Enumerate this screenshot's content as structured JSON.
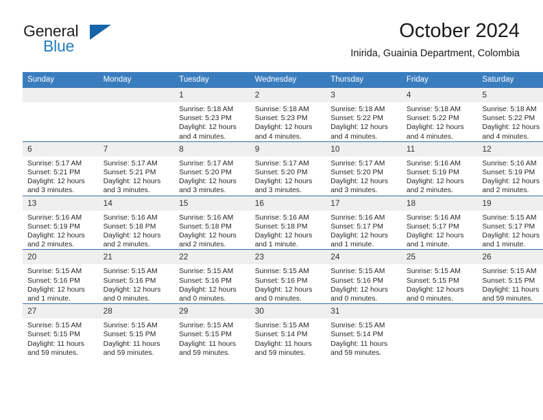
{
  "brand": {
    "name_part1": "General",
    "name_part2": "Blue",
    "triangle_color": "#1565a8"
  },
  "header": {
    "title": "October 2024",
    "location": "Inirida, Guainia Department, Colombia"
  },
  "theme": {
    "header_row_bg": "#3a7dbf",
    "row_divider": "#2f6eae",
    "daynum_bg": "#efefef",
    "text": "#262626"
  },
  "weekday_headers": [
    "Sunday",
    "Monday",
    "Tuesday",
    "Wednesday",
    "Thursday",
    "Friday",
    "Saturday"
  ],
  "weeks": [
    [
      {
        "day": "",
        "empty": true,
        "sunrise": "",
        "sunset": "",
        "daylight1": "",
        "daylight2": ""
      },
      {
        "day": "",
        "empty": true,
        "sunrise": "",
        "sunset": "",
        "daylight1": "",
        "daylight2": ""
      },
      {
        "day": "1",
        "sunrise": "Sunrise: 5:18 AM",
        "sunset": "Sunset: 5:23 PM",
        "daylight1": "Daylight: 12 hours",
        "daylight2": "and 4 minutes."
      },
      {
        "day": "2",
        "sunrise": "Sunrise: 5:18 AM",
        "sunset": "Sunset: 5:23 PM",
        "daylight1": "Daylight: 12 hours",
        "daylight2": "and 4 minutes."
      },
      {
        "day": "3",
        "sunrise": "Sunrise: 5:18 AM",
        "sunset": "Sunset: 5:22 PM",
        "daylight1": "Daylight: 12 hours",
        "daylight2": "and 4 minutes."
      },
      {
        "day": "4",
        "sunrise": "Sunrise: 5:18 AM",
        "sunset": "Sunset: 5:22 PM",
        "daylight1": "Daylight: 12 hours",
        "daylight2": "and 4 minutes."
      },
      {
        "day": "5",
        "sunrise": "Sunrise: 5:18 AM",
        "sunset": "Sunset: 5:22 PM",
        "daylight1": "Daylight: 12 hours",
        "daylight2": "and 4 minutes."
      }
    ],
    [
      {
        "day": "6",
        "sunrise": "Sunrise: 5:17 AM",
        "sunset": "Sunset: 5:21 PM",
        "daylight1": "Daylight: 12 hours",
        "daylight2": "and 3 minutes."
      },
      {
        "day": "7",
        "sunrise": "Sunrise: 5:17 AM",
        "sunset": "Sunset: 5:21 PM",
        "daylight1": "Daylight: 12 hours",
        "daylight2": "and 3 minutes."
      },
      {
        "day": "8",
        "sunrise": "Sunrise: 5:17 AM",
        "sunset": "Sunset: 5:20 PM",
        "daylight1": "Daylight: 12 hours",
        "daylight2": "and 3 minutes."
      },
      {
        "day": "9",
        "sunrise": "Sunrise: 5:17 AM",
        "sunset": "Sunset: 5:20 PM",
        "daylight1": "Daylight: 12 hours",
        "daylight2": "and 3 minutes."
      },
      {
        "day": "10",
        "sunrise": "Sunrise: 5:17 AM",
        "sunset": "Sunset: 5:20 PM",
        "daylight1": "Daylight: 12 hours",
        "daylight2": "and 3 minutes."
      },
      {
        "day": "11",
        "sunrise": "Sunrise: 5:16 AM",
        "sunset": "Sunset: 5:19 PM",
        "daylight1": "Daylight: 12 hours",
        "daylight2": "and 2 minutes."
      },
      {
        "day": "12",
        "sunrise": "Sunrise: 5:16 AM",
        "sunset": "Sunset: 5:19 PM",
        "daylight1": "Daylight: 12 hours",
        "daylight2": "and 2 minutes."
      }
    ],
    [
      {
        "day": "13",
        "sunrise": "Sunrise: 5:16 AM",
        "sunset": "Sunset: 5:19 PM",
        "daylight1": "Daylight: 12 hours",
        "daylight2": "and 2 minutes."
      },
      {
        "day": "14",
        "sunrise": "Sunrise: 5:16 AM",
        "sunset": "Sunset: 5:18 PM",
        "daylight1": "Daylight: 12 hours",
        "daylight2": "and 2 minutes."
      },
      {
        "day": "15",
        "sunrise": "Sunrise: 5:16 AM",
        "sunset": "Sunset: 5:18 PM",
        "daylight1": "Daylight: 12 hours",
        "daylight2": "and 2 minutes."
      },
      {
        "day": "16",
        "sunrise": "Sunrise: 5:16 AM",
        "sunset": "Sunset: 5:18 PM",
        "daylight1": "Daylight: 12 hours",
        "daylight2": "and 1 minute."
      },
      {
        "day": "17",
        "sunrise": "Sunrise: 5:16 AM",
        "sunset": "Sunset: 5:17 PM",
        "daylight1": "Daylight: 12 hours",
        "daylight2": "and 1 minute."
      },
      {
        "day": "18",
        "sunrise": "Sunrise: 5:16 AM",
        "sunset": "Sunset: 5:17 PM",
        "daylight1": "Daylight: 12 hours",
        "daylight2": "and 1 minute."
      },
      {
        "day": "19",
        "sunrise": "Sunrise: 5:15 AM",
        "sunset": "Sunset: 5:17 PM",
        "daylight1": "Daylight: 12 hours",
        "daylight2": "and 1 minute."
      }
    ],
    [
      {
        "day": "20",
        "sunrise": "Sunrise: 5:15 AM",
        "sunset": "Sunset: 5:16 PM",
        "daylight1": "Daylight: 12 hours",
        "daylight2": "and 1 minute."
      },
      {
        "day": "21",
        "sunrise": "Sunrise: 5:15 AM",
        "sunset": "Sunset: 5:16 PM",
        "daylight1": "Daylight: 12 hours",
        "daylight2": "and 0 minutes."
      },
      {
        "day": "22",
        "sunrise": "Sunrise: 5:15 AM",
        "sunset": "Sunset: 5:16 PM",
        "daylight1": "Daylight: 12 hours",
        "daylight2": "and 0 minutes."
      },
      {
        "day": "23",
        "sunrise": "Sunrise: 5:15 AM",
        "sunset": "Sunset: 5:16 PM",
        "daylight1": "Daylight: 12 hours",
        "daylight2": "and 0 minutes."
      },
      {
        "day": "24",
        "sunrise": "Sunrise: 5:15 AM",
        "sunset": "Sunset: 5:16 PM",
        "daylight1": "Daylight: 12 hours",
        "daylight2": "and 0 minutes."
      },
      {
        "day": "25",
        "sunrise": "Sunrise: 5:15 AM",
        "sunset": "Sunset: 5:15 PM",
        "daylight1": "Daylight: 12 hours",
        "daylight2": "and 0 minutes."
      },
      {
        "day": "26",
        "sunrise": "Sunrise: 5:15 AM",
        "sunset": "Sunset: 5:15 PM",
        "daylight1": "Daylight: 11 hours",
        "daylight2": "and 59 minutes."
      }
    ],
    [
      {
        "day": "27",
        "sunrise": "Sunrise: 5:15 AM",
        "sunset": "Sunset: 5:15 PM",
        "daylight1": "Daylight: 11 hours",
        "daylight2": "and 59 minutes."
      },
      {
        "day": "28",
        "sunrise": "Sunrise: 5:15 AM",
        "sunset": "Sunset: 5:15 PM",
        "daylight1": "Daylight: 11 hours",
        "daylight2": "and 59 minutes."
      },
      {
        "day": "29",
        "sunrise": "Sunrise: 5:15 AM",
        "sunset": "Sunset: 5:15 PM",
        "daylight1": "Daylight: 11 hours",
        "daylight2": "and 59 minutes."
      },
      {
        "day": "30",
        "sunrise": "Sunrise: 5:15 AM",
        "sunset": "Sunset: 5:14 PM",
        "daylight1": "Daylight: 11 hours",
        "daylight2": "and 59 minutes."
      },
      {
        "day": "31",
        "sunrise": "Sunrise: 5:15 AM",
        "sunset": "Sunset: 5:14 PM",
        "daylight1": "Daylight: 11 hours",
        "daylight2": "and 59 minutes."
      },
      {
        "day": "",
        "empty": true,
        "sunrise": "",
        "sunset": "",
        "daylight1": "",
        "daylight2": ""
      },
      {
        "day": "",
        "empty": true,
        "sunrise": "",
        "sunset": "",
        "daylight1": "",
        "daylight2": ""
      }
    ]
  ]
}
